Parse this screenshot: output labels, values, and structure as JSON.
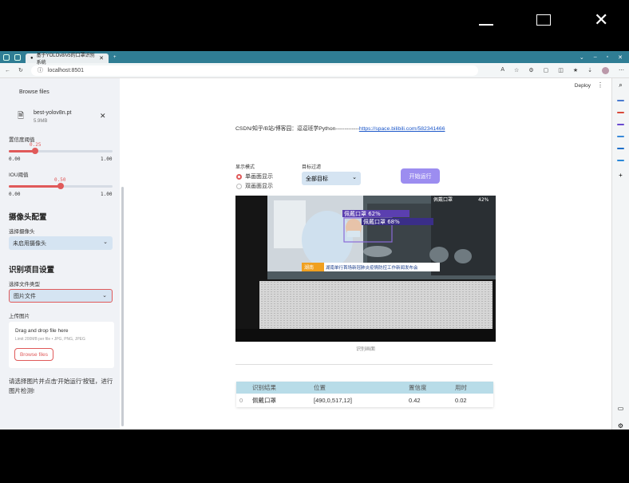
{
  "window": {
    "minimize": "—",
    "maximize": "☐",
    "close": "✕"
  },
  "browser": {
    "tab_title": "基于YOLOv8/v5的口罩识别系统",
    "tab_close": "✕",
    "new_tab": "+",
    "url": "localhost:8501",
    "url_prefix": "ⓘ"
  },
  "sidebar": {
    "browse_top": "Browse files",
    "file": {
      "name": "best-yolov8n.pt",
      "size": "5.9MB",
      "close": "✕"
    },
    "conf": {
      "label": "置信度阈值",
      "value": "0.25",
      "value_num": 0.25,
      "min": "0.00",
      "max": "1.00"
    },
    "iou": {
      "label": "IOU阈值",
      "value": "0.50",
      "value_num": 0.5,
      "min": "0.00",
      "max": "1.00"
    },
    "camera_header": "摄像头配置",
    "camera_label": "选择摄像头",
    "camera_value": "未启用摄像头",
    "project_header": "识别项目设置",
    "filetype_label": "选择文件类型",
    "filetype_value": "图片文件",
    "upload_label": "上传图片",
    "upload_drag": "Drag and drop file here",
    "upload_limit": "Limit 200MB per file • JPG, PNG, JPEG",
    "upload_button": "Browse files",
    "message": "请选择图片并点击'开始运行'按钮，进行图片检测!"
  },
  "main": {
    "deploy": "Deploy",
    "menu": "⋮",
    "csdn_text": "CSDN/知乎/B站/博客园：逗逗班学Python-------------",
    "csdn_link": "https://space.bilibili.com/582341466",
    "mode_label": "显示模式",
    "mode_single": "单画面显示",
    "mode_dual": "双画面显示",
    "filter_label": "目标过滤",
    "filter_value": "全部目标",
    "run_button": "开始运行",
    "photo_overlay": {
      "det1": "佩戴口罩 62%",
      "det2": "佩戴口罩 68%",
      "det3": "佩戴口罩",
      "corner": "42%",
      "news": "湖南单行首场新冠肺炎疫情防控工作新闻发布会",
      "brand": "湖南"
    },
    "caption": "识别画面",
    "table": {
      "headers": [
        "识别结果",
        "位置",
        "置信度",
        "用时"
      ],
      "rows": [
        {
          "idx": "0",
          "result": "佩戴口罩",
          "pos": "[490,0,517,12]",
          "conf": "0.42",
          "time": "0.02"
        }
      ]
    }
  }
}
